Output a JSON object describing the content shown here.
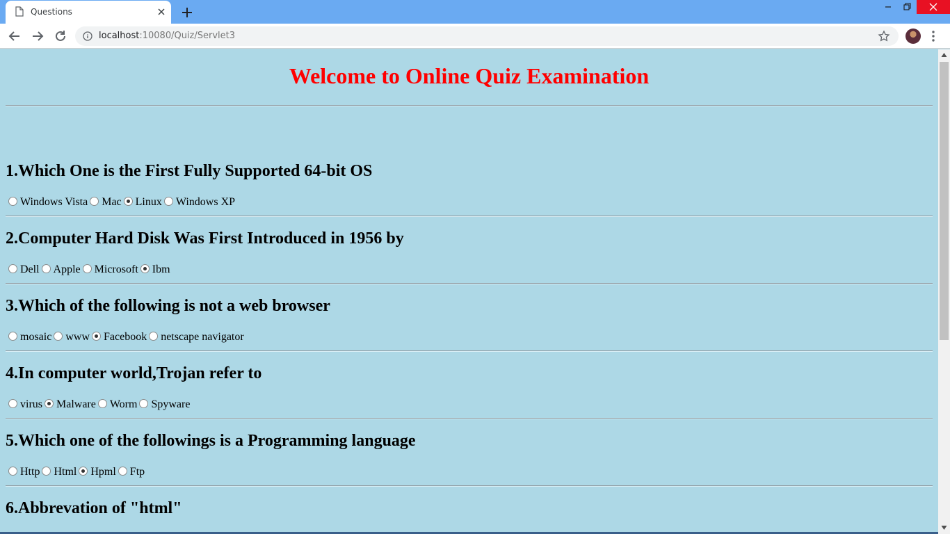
{
  "browser": {
    "tab_title": "Questions",
    "url_host": "localhost",
    "url_path": ":10080/Quiz/Servlet3"
  },
  "page": {
    "title": "Welcome to Online Quiz Examination",
    "title_color": "#ff0000",
    "background_color": "#add8e6"
  },
  "questions": [
    {
      "text": "1.Which One is the First Fully Supported 64-bit OS",
      "options": [
        "Windows Vista",
        "Mac",
        "Linux",
        "Windows XP"
      ],
      "selected": "Linux"
    },
    {
      "text": "2.Computer Hard Disk Was First Introduced in 1956 by",
      "options": [
        "Dell",
        "Apple",
        "Microsoft",
        "Ibm"
      ],
      "selected": "Ibm"
    },
    {
      "text": "3.Which of the following is not a web browser",
      "options": [
        "mosaic",
        "www",
        "Facebook",
        "netscape navigator"
      ],
      "selected": "Facebook"
    },
    {
      "text": "4.In computer world,Trojan refer to",
      "options": [
        "virus",
        "Malware",
        "Worm",
        "Spyware"
      ],
      "selected": "Malware"
    },
    {
      "text": "5.Which one of the followings is a Programming language",
      "options": [
        "Http",
        "Html",
        "Hpml",
        "Ftp"
      ],
      "selected": "Hpml"
    },
    {
      "text": "6.Abbrevation of \"html\"",
      "options": [],
      "selected": ""
    }
  ],
  "icons": [
    "document-icon",
    "close-icon",
    "plus-icon",
    "back-arrow-icon",
    "forward-arrow-icon",
    "reload-icon",
    "info-icon",
    "star-icon",
    "kebab-menu-icon",
    "minimize-icon",
    "restore-icon",
    "window-close-icon",
    "radio-icon"
  ]
}
